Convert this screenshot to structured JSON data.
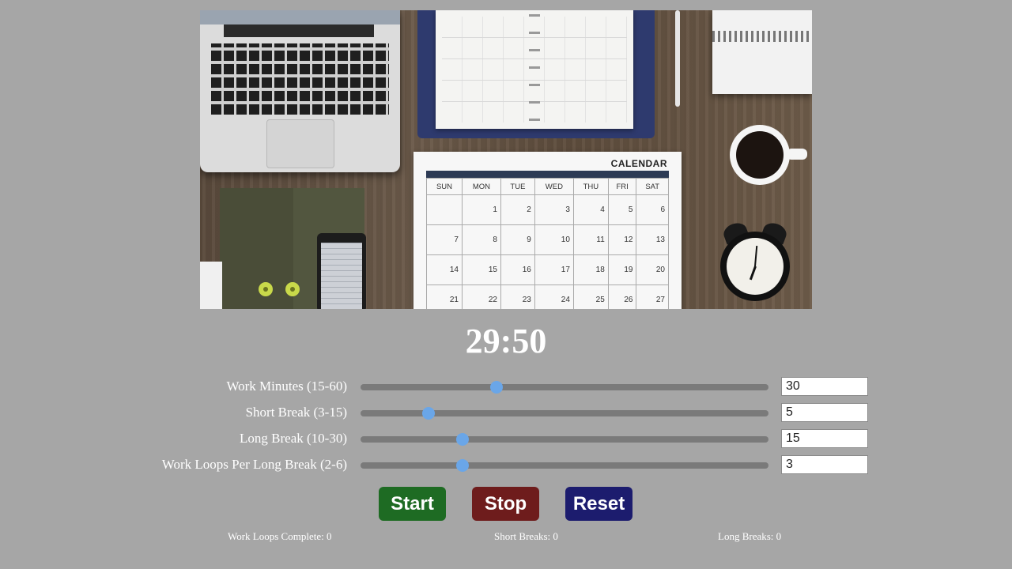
{
  "hero": {
    "calendar_title": "CALENDAR",
    "weekdays": [
      "SUN",
      "MON",
      "TUE",
      "WED",
      "THU",
      "FRI",
      "SAT"
    ],
    "weeks": [
      [
        "",
        "1",
        "2",
        "3",
        "4",
        "5",
        "6"
      ],
      [
        "7",
        "8",
        "9",
        "10",
        "11",
        "12",
        "13"
      ],
      [
        "14",
        "15",
        "16",
        "17",
        "18",
        "19",
        "20"
      ],
      [
        "21",
        "22",
        "23",
        "24",
        "25",
        "26",
        "27"
      ]
    ]
  },
  "timer": {
    "display": "29:50"
  },
  "settings": [
    {
      "label": "Work Minutes (15-60)",
      "min": 15,
      "max": 60,
      "value": "30"
    },
    {
      "label": "Short Break (3-15)",
      "min": 3,
      "max": 15,
      "value": "5"
    },
    {
      "label": "Long Break (10-30)",
      "min": 10,
      "max": 30,
      "value": "15"
    },
    {
      "label": "Work Loops Per Long Break (2-6)",
      "min": 2,
      "max": 6,
      "value": "3"
    }
  ],
  "buttons": {
    "start": {
      "label": "Start",
      "color": "#1e6b23"
    },
    "stop": {
      "label": "Stop",
      "color": "#6e1c1c"
    },
    "reset": {
      "label": "Reset",
      "color": "#1c1c6e"
    }
  },
  "stats": {
    "work_loops": "Work Loops Complete: 0",
    "short_breaks": "Short Breaks: 0",
    "long_breaks": "Long Breaks: 0"
  },
  "colors": {
    "background": "#a6a6a6",
    "slider_track": "#7a7a7a",
    "slider_thumb": "#6aa6e8"
  }
}
